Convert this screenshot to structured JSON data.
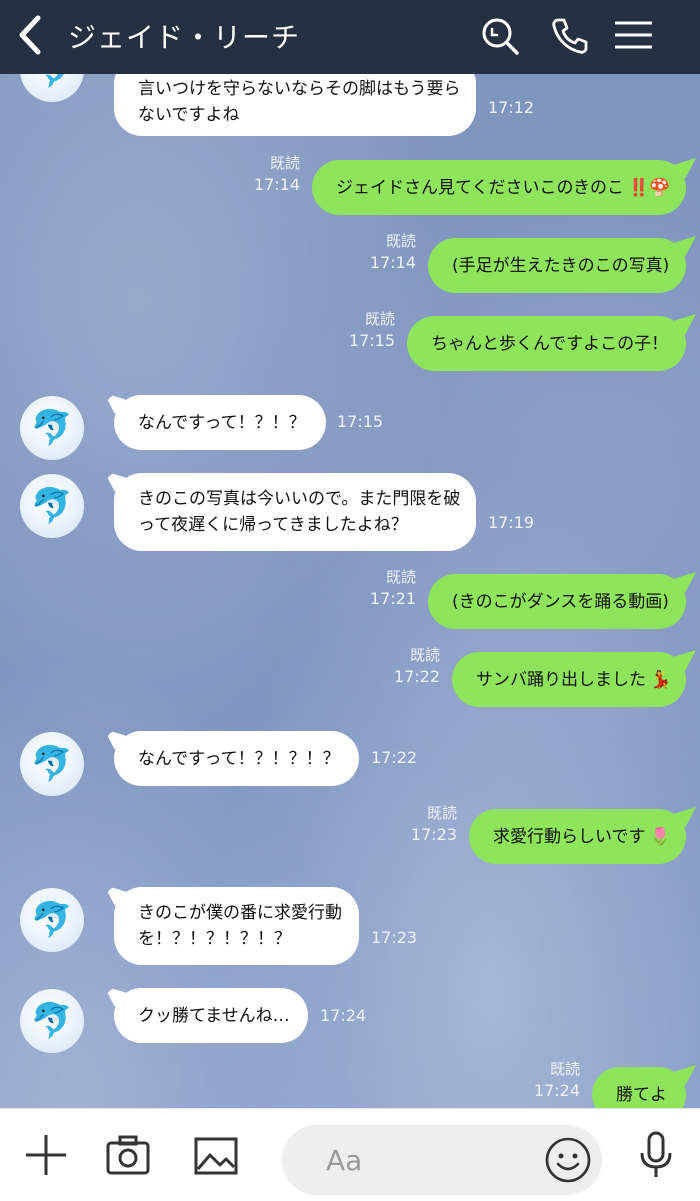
{
  "header": {
    "title": "ジェイド・リーチ",
    "back_icon": "chevron-left-icon",
    "search_icon": "search-icon",
    "phone_icon": "phone-icon",
    "menu_icon": "menu-icon"
  },
  "messages": [
    {
      "side": "in",
      "lines": [
        "言いつけを守らないならその脚はもう要ら",
        "ないですよね"
      ],
      "time": "17:12"
    },
    {
      "side": "out",
      "text": "ジェイドさん見てくださいこのきのこ",
      "emoji": "‼️🍄",
      "read": "既読",
      "time": "17:14"
    },
    {
      "side": "out",
      "text": "(手足が生えたきのこの写真)",
      "read": "既読",
      "time": "17:14"
    },
    {
      "side": "out",
      "text": "ちゃんと歩くんですよこの子！",
      "read": "既読",
      "time": "17:15"
    },
    {
      "side": "in",
      "text": "なんですって！？！？",
      "time": "17:15"
    },
    {
      "side": "in",
      "lines": [
        "きのこの写真は今いいので。また門限を破",
        "って夜遅くに帰ってきましたよね？"
      ],
      "time": "17:19"
    },
    {
      "side": "out",
      "text": "(きのこがダンスを踊る動画)",
      "read": "既読",
      "time": "17:21"
    },
    {
      "side": "out",
      "text": "サンバ踊り出しました",
      "emoji": "💃",
      "read": "既読",
      "time": "17:22"
    },
    {
      "side": "in",
      "text": "なんですって！？！？！？",
      "time": "17:22"
    },
    {
      "side": "out",
      "text": "求愛行動らしいです",
      "emoji": "🌷",
      "read": "既読",
      "time": "17:23"
    },
    {
      "side": "in",
      "lines": [
        "きのこが僕の番に求愛行動",
        "を！？！？！？！？"
      ],
      "time": "17:23"
    },
    {
      "side": "in",
      "text": "クッ勝てませんね…",
      "time": "17:24"
    },
    {
      "side": "out",
      "text": "勝てよ",
      "read": "既読",
      "time": "17:24"
    }
  ],
  "avatar_icon": "dolphin-icon",
  "input": {
    "placeholder": "Aa"
  },
  "toolbar": {
    "plus_icon": "plus-icon",
    "camera_icon": "camera-icon",
    "image_icon": "image-icon",
    "emoji_icon": "smiley-icon",
    "mic_icon": "microphone-icon"
  },
  "colors": {
    "header_bg": "#263043",
    "outgoing_bubble": "#8ee45b",
    "incoming_bubble": "#ffffff",
    "chat_bg": "#8196bf"
  }
}
